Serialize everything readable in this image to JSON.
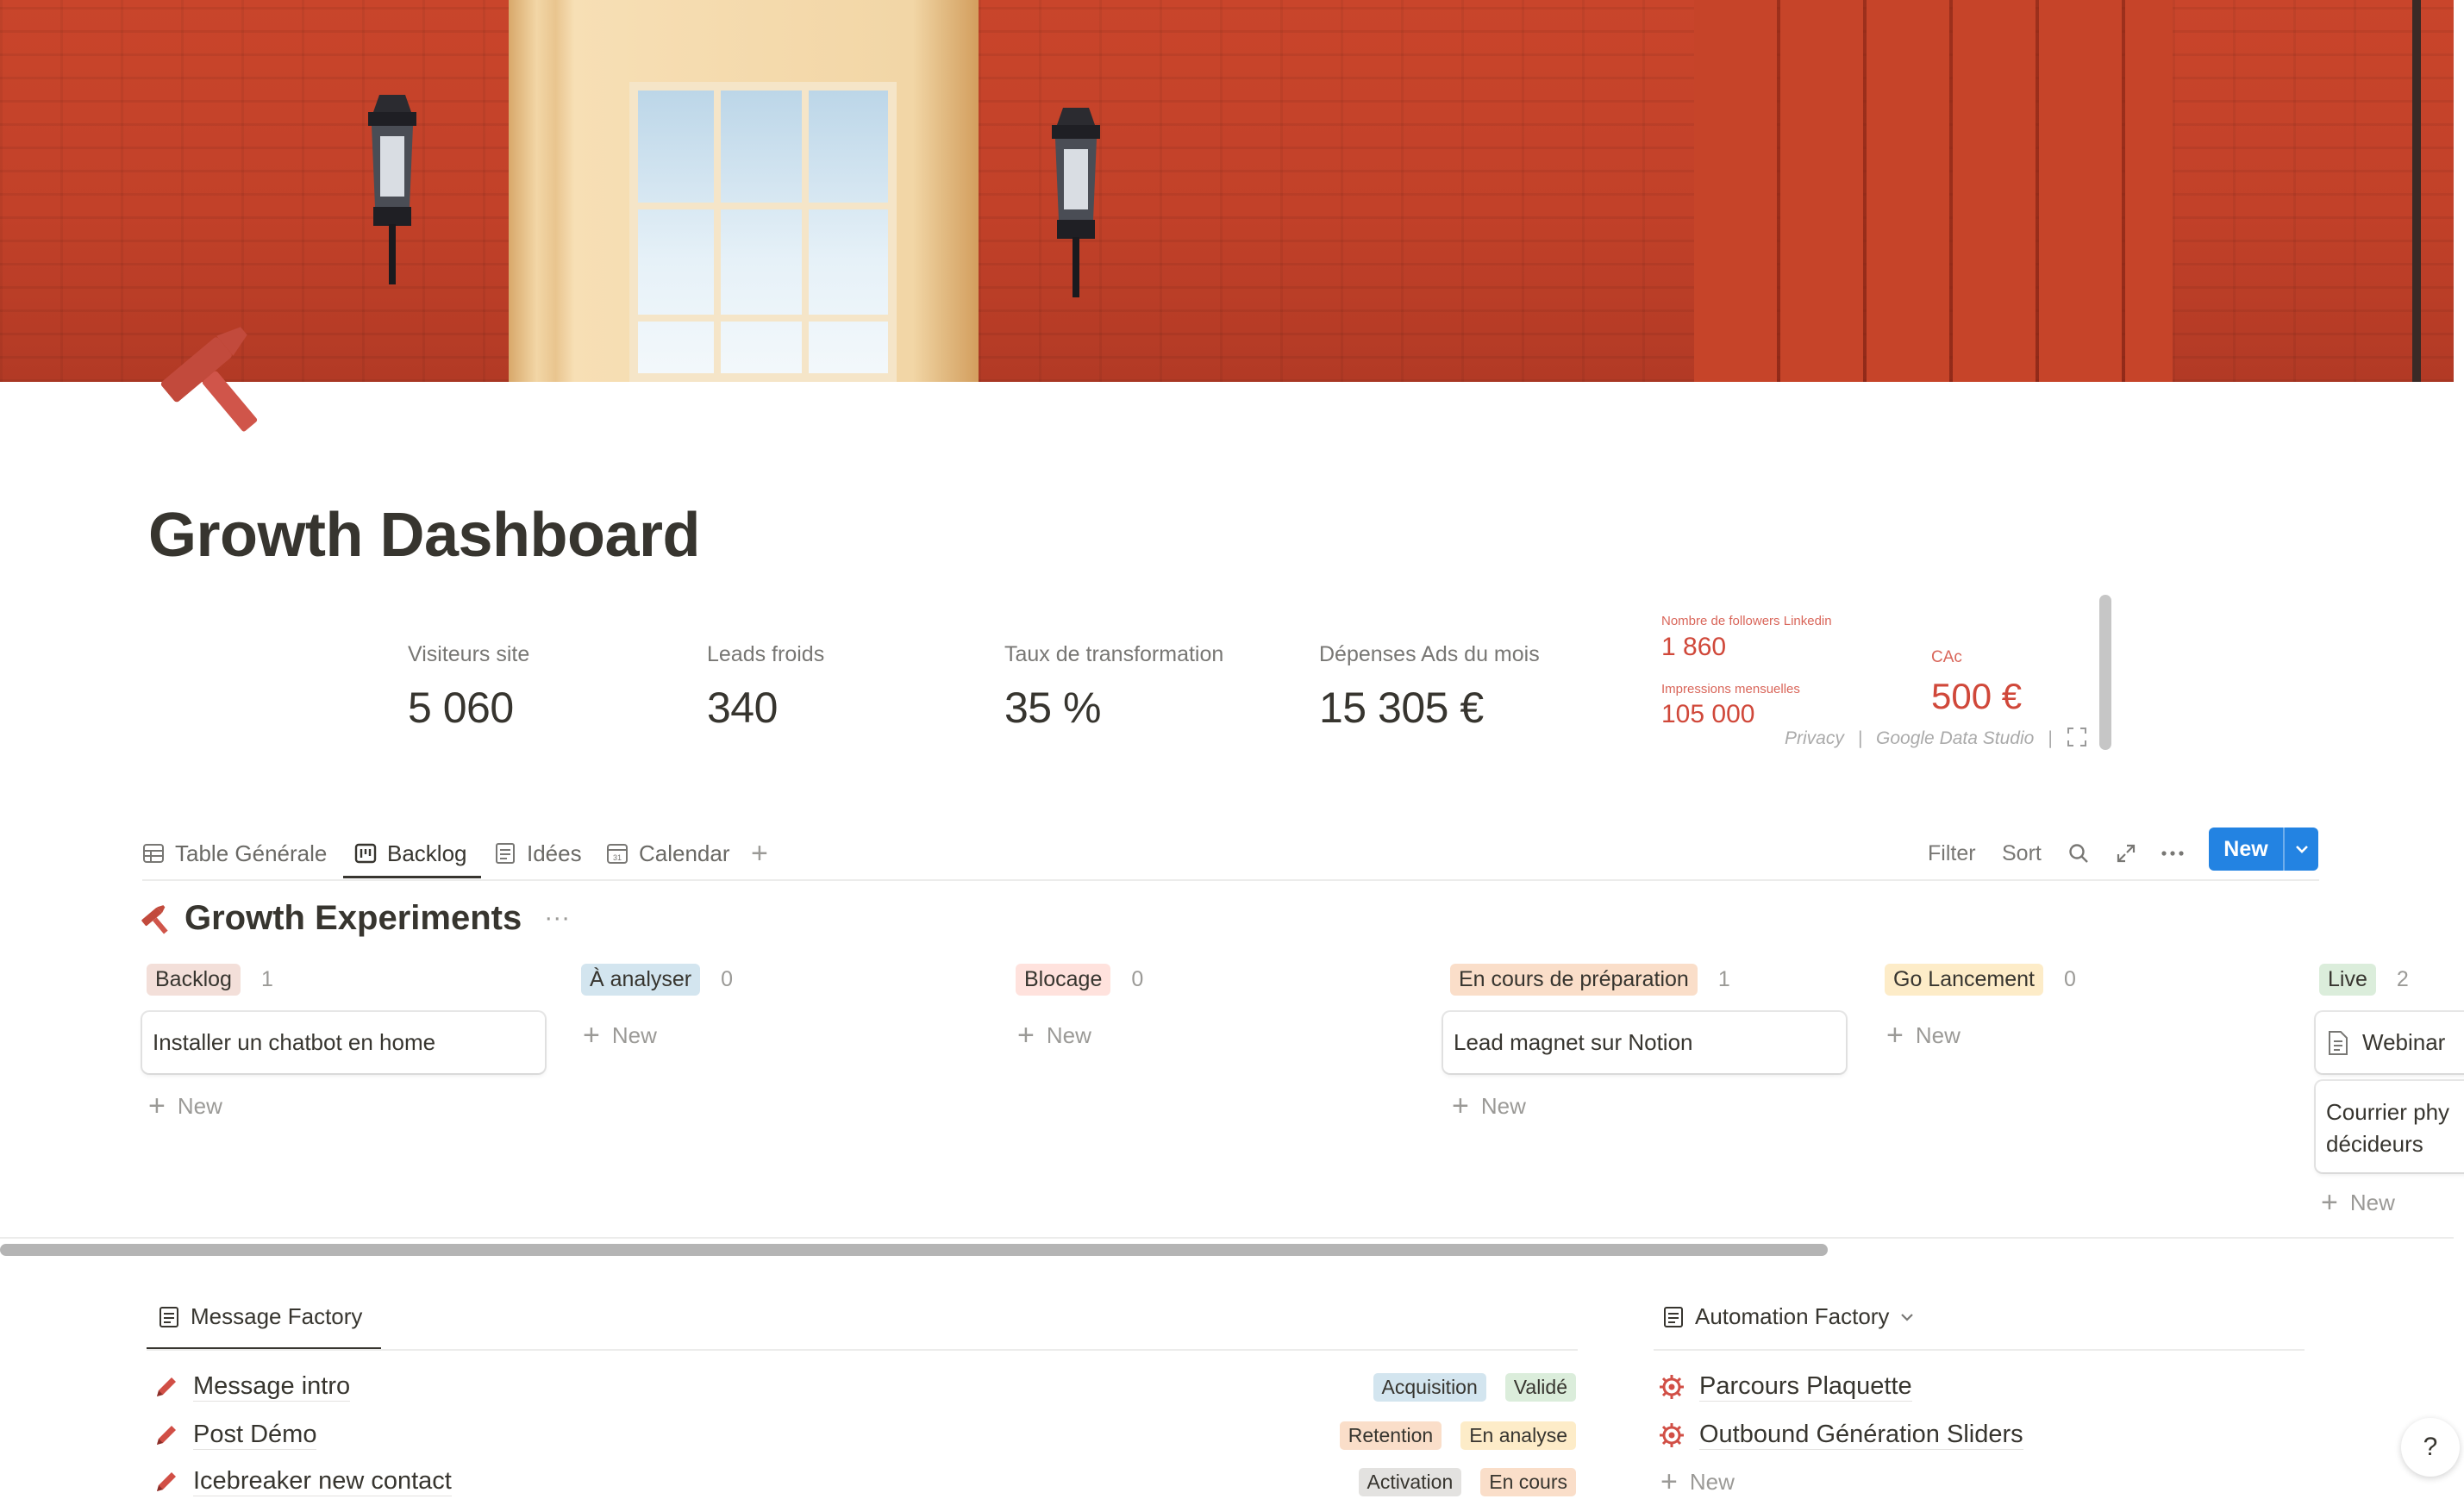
{
  "page": {
    "title": "Growth Dashboard",
    "icon": "hammer-icon"
  },
  "metrics": [
    {
      "label": "Visiteurs site",
      "value": "5 060"
    },
    {
      "label": "Leads froids",
      "value": "340"
    },
    {
      "label": "Taux de transformation",
      "value": "35 %"
    },
    {
      "label": "Dépenses Ads du mois",
      "value": "15 305 €"
    }
  ],
  "embed": {
    "followers_label": "Nombre de followers Linkedin",
    "followers_value": "1 860",
    "impressions_label": "Impressions mensuelles",
    "impressions_value": "105 000",
    "cac_label": "CAc",
    "cac_value": "500 €",
    "privacy": "Privacy",
    "sep": "|",
    "studio": "Google Data Studio",
    "accent": "#d0483a"
  },
  "views": {
    "tabs": [
      {
        "label": "Table Générale",
        "icon": "table-icon"
      },
      {
        "label": "Backlog",
        "icon": "board-icon",
        "active": true
      },
      {
        "label": "Idées",
        "icon": "list-icon"
      },
      {
        "label": "Calendar",
        "icon": "calendar-icon"
      }
    ],
    "add": "+",
    "filter": "Filter",
    "sort": "Sort",
    "new_button": "New",
    "new_color": "#2383e2"
  },
  "board": {
    "title": "Growth Experiments",
    "more": "···",
    "columns": [
      {
        "name": "Backlog",
        "count": "1",
        "color": "#f3dfd9",
        "cards": [
          "Installer un chatbot en home"
        ],
        "new": "New"
      },
      {
        "name": "À analyser",
        "count": "0",
        "color": "#d3e5ef",
        "cards": [],
        "new": "New"
      },
      {
        "name": "Blocage",
        "count": "0",
        "color": "#ffe2dd",
        "cards": [],
        "new": "New"
      },
      {
        "name": "En cours de préparation",
        "count": "1",
        "color": "#fadec9",
        "cards": [
          "Lead magnet sur Notion"
        ],
        "new": "New"
      },
      {
        "name": "Go Lancement",
        "count": "0",
        "color": "#fdecc8",
        "cards": [],
        "new": "New"
      },
      {
        "name": "Live",
        "count": "2",
        "color": "#dbeddb",
        "cards": [
          "Webinar",
          "Courrier phy",
          "décideurs"
        ],
        "new": "New"
      }
    ]
  },
  "message_factory": {
    "tab": "Message Factory",
    "rows": [
      {
        "title": "Message intro",
        "tags": [
          {
            "label": "Acquisition",
            "color": "#d3e5ef"
          },
          {
            "label": "Validé",
            "color": "#dbeddb"
          }
        ]
      },
      {
        "title": "Post Démo",
        "tags": [
          {
            "label": "Retention",
            "color": "#fadec9"
          },
          {
            "label": "En analyse",
            "color": "#fdecc8"
          }
        ]
      },
      {
        "title": "Icebreaker new contact",
        "tags": [
          {
            "label": "Activation",
            "color": "#e3e2e0"
          },
          {
            "label": "En cours",
            "color": "#fadec9"
          }
        ]
      }
    ]
  },
  "automation_factory": {
    "tab": "Automation Factory",
    "rows": [
      "Parcours Plaquette",
      "Outbound Génération Sliders"
    ],
    "new": "New"
  },
  "help": "?"
}
